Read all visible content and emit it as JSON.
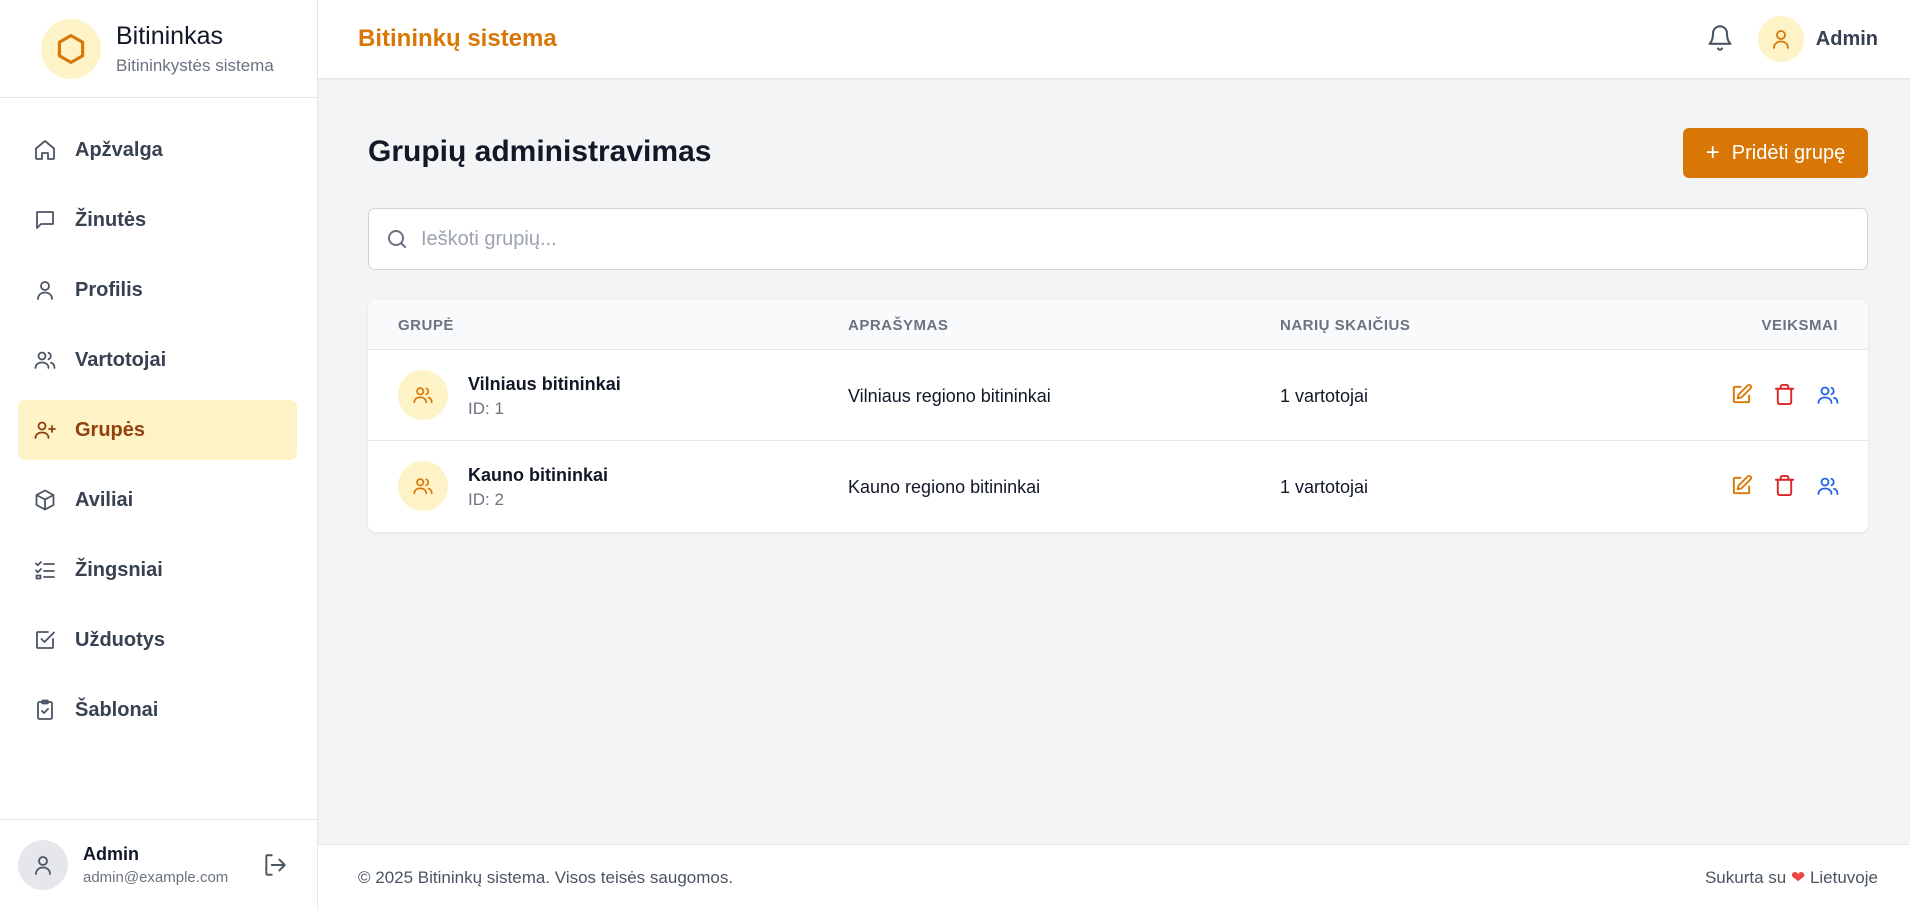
{
  "brand": {
    "name": "Bitininkas",
    "subtitle": "Bitininkystės sistema",
    "logo_icon": "hexagon-icon",
    "accent": "#d97706"
  },
  "sidebar": {
    "items": [
      {
        "label": "Apžvalga",
        "icon": "home-icon",
        "active": false
      },
      {
        "label": "Žinutės",
        "icon": "message-icon",
        "active": false
      },
      {
        "label": "Profilis",
        "icon": "user-icon",
        "active": false
      },
      {
        "label": "Vartotojai",
        "icon": "users-icon",
        "active": false
      },
      {
        "label": "Grupės",
        "icon": "user-plus-icon",
        "active": true
      },
      {
        "label": "Aviliai",
        "icon": "box-icon",
        "active": false
      },
      {
        "label": "Žingsniai",
        "icon": "list-checks-icon",
        "active": false
      },
      {
        "label": "Užduotys",
        "icon": "checkbox-icon",
        "active": false
      },
      {
        "label": "Šablonai",
        "icon": "clipboard-check-icon",
        "active": false
      }
    ],
    "user": {
      "name": "Admin",
      "email": "admin@example.com"
    }
  },
  "header": {
    "title": "Bitininkų sistema",
    "user_name": "Admin"
  },
  "main": {
    "title": "Grupių administravimas",
    "add_button": "Pridėti grupę",
    "search_placeholder": "Ieškoti grupių..."
  },
  "table": {
    "headers": {
      "group": "GRUPĖ",
      "description": "APRAŠYMAS",
      "members": "NARIŲ SKAIČIUS",
      "actions": "VEIKSMAI"
    },
    "rows": [
      {
        "name": "Vilniaus bitininkai",
        "id": "ID: 1",
        "description": "Vilniaus regiono bitininkai",
        "members": "1 vartotojai"
      },
      {
        "name": "Kauno bitininkai",
        "id": "ID: 2",
        "description": "Kauno regiono bitininkai",
        "members": "1 vartotojai"
      }
    ]
  },
  "footer": {
    "left": "© 2025 Bitininkų sistema. Visos teisės saugomos.",
    "right_prefix": "Sukurta su",
    "heart": "❤",
    "right_suffix": "Lietuvoje"
  }
}
